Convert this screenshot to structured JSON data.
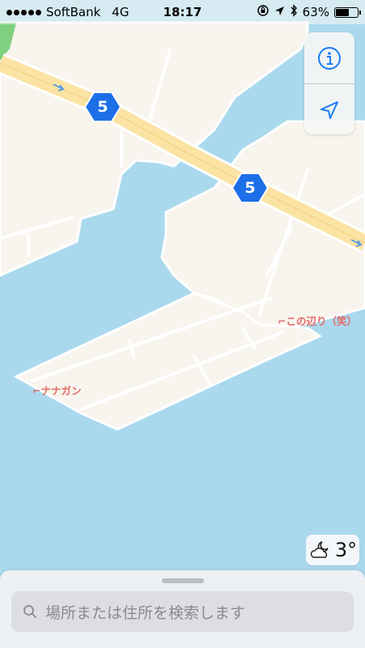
{
  "status_bar": {
    "carrier": "SoftBank",
    "network": "4G",
    "time": "18:17",
    "battery_percent": "63%",
    "battery_level": 0.63,
    "icons": [
      "signal-dots-icon",
      "rotation-lock-icon",
      "location-arrow-icon",
      "bluetooth-icon",
      "battery-icon"
    ]
  },
  "map": {
    "route_shields": [
      {
        "label": "5"
      },
      {
        "label": "5"
      }
    ],
    "poi_labels": {
      "konoatari": "この辺り（笑）",
      "nanagan": "ナナガン"
    },
    "colors": {
      "water": "#aad9ee",
      "land": "#f8f4ee",
      "highway": "#fbe3a4",
      "shield": "#1d6fe8",
      "poi": "#e56a67",
      "park": "#7fd07f"
    }
  },
  "controls": {
    "info_icon": "info-icon",
    "location_icon": "location-arrow-icon"
  },
  "weather": {
    "icon": "partly-cloudy-night-icon",
    "temperature": "3°"
  },
  "search": {
    "placeholder": "場所または住所を検索します",
    "icon": "search-icon"
  }
}
